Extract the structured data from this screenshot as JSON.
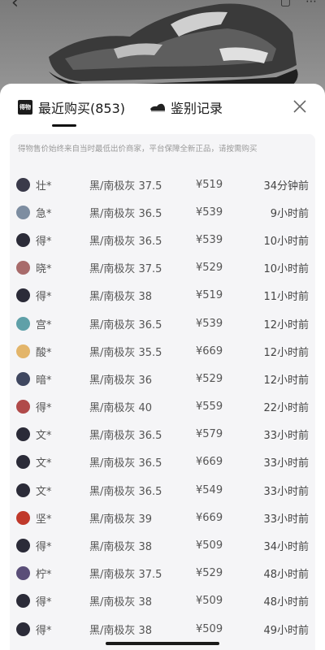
{
  "tabs": [
    {
      "logo_text": "得物",
      "label": "最近购买(853)"
    },
    {
      "label": "鉴别记录"
    }
  ],
  "notice": "得物售价始终来自当时最低出价商家，平台保障全新正品，请按需购买",
  "rows": [
    {
      "user": "壮*",
      "spec": "黑/南极灰 37.5",
      "price": "¥519",
      "time": "34分钟前",
      "avatar_color": "#3a3a4a"
    },
    {
      "user": "急*",
      "spec": "黑/南极灰 36.5",
      "price": "¥539",
      "time": "9小时前",
      "avatar_color": "#7d8da1"
    },
    {
      "user": "得*",
      "spec": "黑/南极灰 36.5",
      "price": "¥539",
      "time": "10小时前",
      "avatar_color": "#2b2b38"
    },
    {
      "user": "晓*",
      "spec": "黑/南极灰 37.5",
      "price": "¥529",
      "time": "10小时前",
      "avatar_color": "#a86b6b"
    },
    {
      "user": "得*",
      "spec": "黑/南极灰 38",
      "price": "¥519",
      "time": "11小时前",
      "avatar_color": "#2b2b38"
    },
    {
      "user": "宫*",
      "spec": "黑/南极灰 36.5",
      "price": "¥539",
      "time": "12小时前",
      "avatar_color": "#5fa0a8"
    },
    {
      "user": "酸*",
      "spec": "黑/南极灰 35.5",
      "price": "¥669",
      "time": "12小时前",
      "avatar_color": "#e3b56a"
    },
    {
      "user": "暗*",
      "spec": "黑/南极灰 36",
      "price": "¥529",
      "time": "12小时前",
      "avatar_color": "#3f4760"
    },
    {
      "user": "得*",
      "spec": "黑/南极灰 40",
      "price": "¥559",
      "time": "22小时前",
      "avatar_color": "#b04a4a"
    },
    {
      "user": "文*",
      "spec": "黑/南极灰 36.5",
      "price": "¥579",
      "time": "33小时前",
      "avatar_color": "#2b2b38"
    },
    {
      "user": "文*",
      "spec": "黑/南极灰 36.5",
      "price": "¥669",
      "time": "33小时前",
      "avatar_color": "#2b2b38"
    },
    {
      "user": "文*",
      "spec": "黑/南极灰 36.5",
      "price": "¥549",
      "time": "33小时前",
      "avatar_color": "#2b2b38"
    },
    {
      "user": "坚*",
      "spec": "黑/南极灰 39",
      "price": "¥669",
      "time": "33小时前",
      "avatar_color": "#c0392b"
    },
    {
      "user": "得*",
      "spec": "黑/南极灰 38",
      "price": "¥509",
      "time": "34小时前",
      "avatar_color": "#2b2b38"
    },
    {
      "user": "柠*",
      "spec": "黑/南极灰 37.5",
      "price": "¥529",
      "time": "48小时前",
      "avatar_color": "#5a4e78"
    },
    {
      "user": "得*",
      "spec": "黑/南极灰 38",
      "price": "¥509",
      "time": "48小时前",
      "avatar_color": "#2b2b38"
    },
    {
      "user": "得*",
      "spec": "黑/南极灰 38",
      "price": "¥509",
      "time": "49小时前",
      "avatar_color": "#2b2b38"
    }
  ]
}
